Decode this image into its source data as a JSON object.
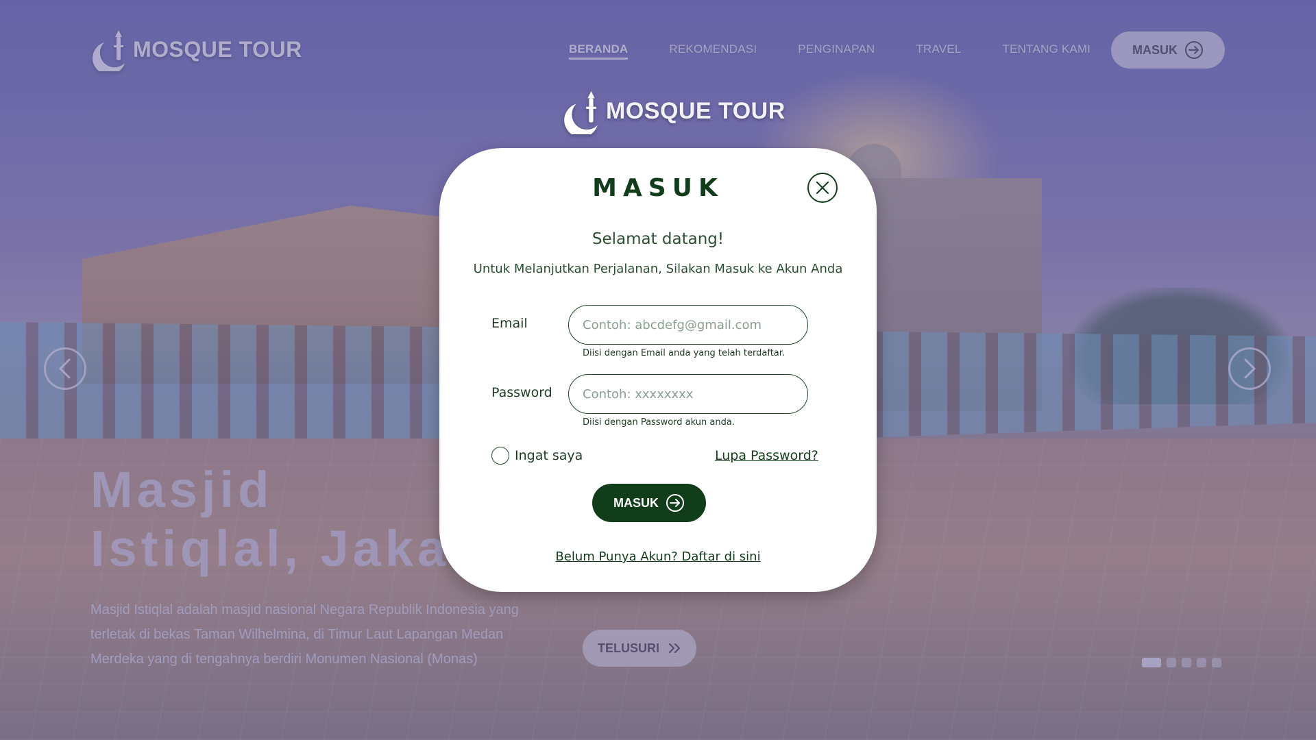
{
  "brand": {
    "name": "MOSQUE TOUR"
  },
  "nav": {
    "items": [
      {
        "label": "BERANDA",
        "active": true
      },
      {
        "label": "REKOMENDASI",
        "active": false
      },
      {
        "label": "PENGINAPAN",
        "active": false
      },
      {
        "label": "TRAVEL",
        "active": false
      },
      {
        "label": "TENTANG KAMI",
        "active": false
      }
    ],
    "login_button": {
      "label": "MASUK",
      "icon": "arrow-right-circle-icon"
    }
  },
  "hero": {
    "title_line1": "Masjid",
    "title_line2": "Istiqlal, Jakarta",
    "description": "Masjid Istiqlal adalah masjid nasional Negara Republik Indonesia yang terletak di bekas Taman Wilhelmina, di Timur Laut Lapangan Medan Merdeka yang di tengahnya berdiri Monumen Nasional (Monas)",
    "explore_button": {
      "label": "TELUSURI",
      "icon": "double-chevron-right-icon"
    },
    "slides_total": 5,
    "slide_active": 1
  },
  "login_modal": {
    "title": "MASUK",
    "welcome": "Selamat datang!",
    "subtitle": "Untuk Melanjutkan Perjalanan, Silakan Masuk ke Akun Anda",
    "email": {
      "label": "Email",
      "value": "",
      "placeholder": "Contoh: abcdefg@gmail.com",
      "hint": "Diisi dengan Email anda yang telah terdaftar."
    },
    "password": {
      "label": "Password",
      "value": "",
      "placeholder": "Contoh: xxxxxxxx",
      "hint": "Diisi dengan Password akun anda."
    },
    "remember_label": "Ingat saya",
    "remember_checked": false,
    "forgot_label": "Lupa Password?",
    "submit_label": "MASUK",
    "register_label": "Belum Punya Akun? Daftar di sini"
  },
  "colors": {
    "primary": "#113d1b",
    "modal_bg": "#ffffff",
    "overlay": "#5f5c96"
  }
}
